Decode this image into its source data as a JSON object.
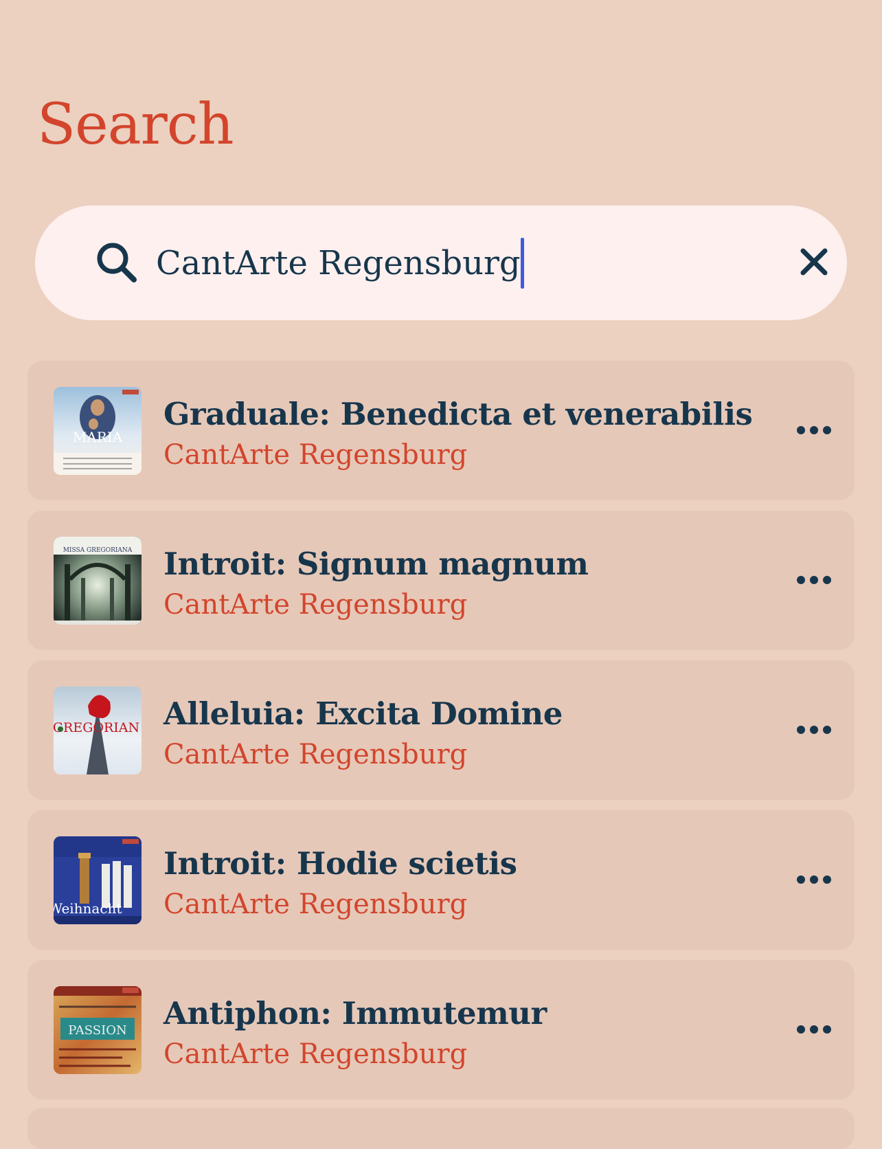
{
  "page": {
    "title": "Search"
  },
  "search": {
    "value": "CantArte Regensburg",
    "search_icon": "search-icon",
    "clear_icon": "close-icon"
  },
  "results": [
    {
      "title": "Graduale: Benedicta et venerabilis",
      "artist": "CantArte Regensburg",
      "cover_text": "MARIA"
    },
    {
      "title": "Introit: Signum magnum",
      "artist": "CantArte Regensburg",
      "cover_text": "MISSA GREGORIANA"
    },
    {
      "title": "Alleluia: Excita Domine",
      "artist": "CantArte Regensburg",
      "cover_text": "GREGORIAN"
    },
    {
      "title": "Introit: Hodie scietis",
      "artist": "CantArte Regensburg",
      "cover_text": "Weihnacht"
    },
    {
      "title": "Antiphon: Immutemur",
      "artist": "CantArte Regensburg",
      "cover_text": "PASSION"
    }
  ],
  "colors": {
    "background": "#ecd0c0",
    "accent": "#d2452c",
    "text_primary": "#17364c",
    "card": "#e6c8b8",
    "search_bg": "#fdf0ee",
    "caret": "#3d5ae0"
  }
}
